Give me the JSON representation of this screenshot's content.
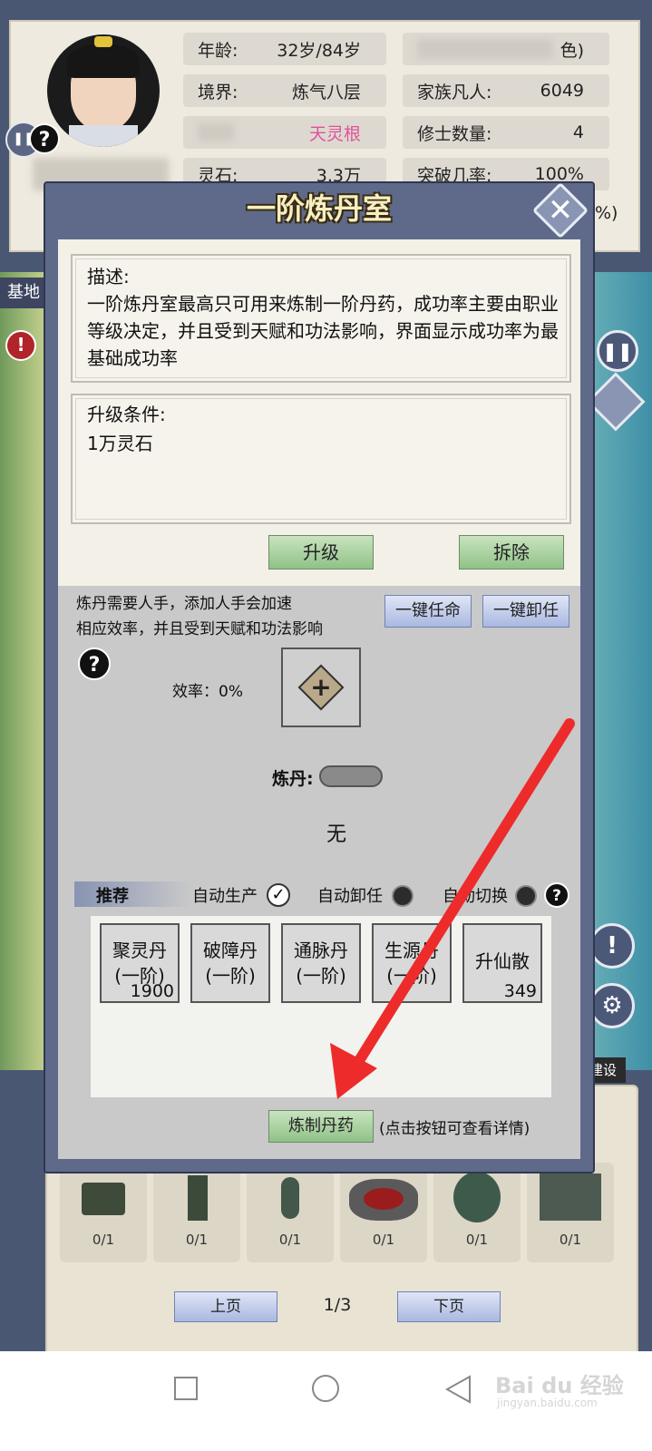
{
  "status": {
    "age_label": "年龄:",
    "age_value": "32岁/84岁",
    "realm_label": "境界:",
    "realm_value": "炼气八层",
    "root_value": "天灵根",
    "stone_label": "灵石:",
    "stone_value": "3.3万",
    "mortal_label": "家族凡人:",
    "mortal_value": "6049",
    "cultivator_label": "修士数量:",
    "cultivator_value": "4",
    "breakthrough_label": "突破几率:",
    "breakthrough_value": "100%",
    "partial_right_1": "色)",
    "partial_right_2": "%)"
  },
  "side": {
    "base_tab": "基地",
    "build_tab": "建设"
  },
  "dialog": {
    "title": "一阶炼丹室",
    "close_icon": "close-x-icon",
    "desc_title": "描述:",
    "desc_text": "一阶炼丹室最高只可用来炼制一阶丹药，成功率主要由职业等级决定，并且受到天赋和功法影响，界面显示成功率为最基础成功率",
    "upgrade_title": "升级条件:",
    "upgrade_text": "1万灵石",
    "upgrade_button": "升级",
    "demolish_button": "拆除",
    "staff_text_1": "炼丹需要人手，添加人手会加速",
    "staff_text_2": "相应效率，并且受到天赋和功法影响",
    "assign_all_button": "一键任命",
    "dismiss_all_button": "一键卸任",
    "help_icon": "?",
    "efficiency_label": "效率：0%",
    "refine_label": "炼丹:",
    "refine_value": "无",
    "recommend_label": "推荐",
    "auto_produce_label": "自动生产",
    "auto_dismiss_label": "自动卸任",
    "auto_switch_label": "自动切换",
    "recipes": [
      {
        "name": "聚灵丹",
        "tier": "(一阶)",
        "count": "1900"
      },
      {
        "name": "破障丹",
        "tier": "(一阶)",
        "count": ""
      },
      {
        "name": "通脉丹",
        "tier": "(一阶)",
        "count": ""
      },
      {
        "name": "生源丹",
        "tier": "(一阶)",
        "count": ""
      },
      {
        "name": "升仙散",
        "tier": "",
        "count": "349"
      }
    ],
    "craft_button": "炼制丹药",
    "craft_hint": "(点击按钮可查看详情)"
  },
  "buildings": {
    "counts": [
      "0/1",
      "0/1",
      "0/1",
      "0/1",
      "0/1",
      "0/1"
    ],
    "prev_page": "上页",
    "page_indicator": "1/3",
    "next_page": "下页"
  },
  "watermark": "Bai du 经验",
  "watermark_sub": "jingyan.baidu.com",
  "colors": {
    "dialog_frame": "#5f6a8a",
    "green_button": "#8fc288",
    "blue_button": "#aab8e0",
    "root_pink": "#e0529a",
    "arrow_red": "#ee2b2b"
  }
}
